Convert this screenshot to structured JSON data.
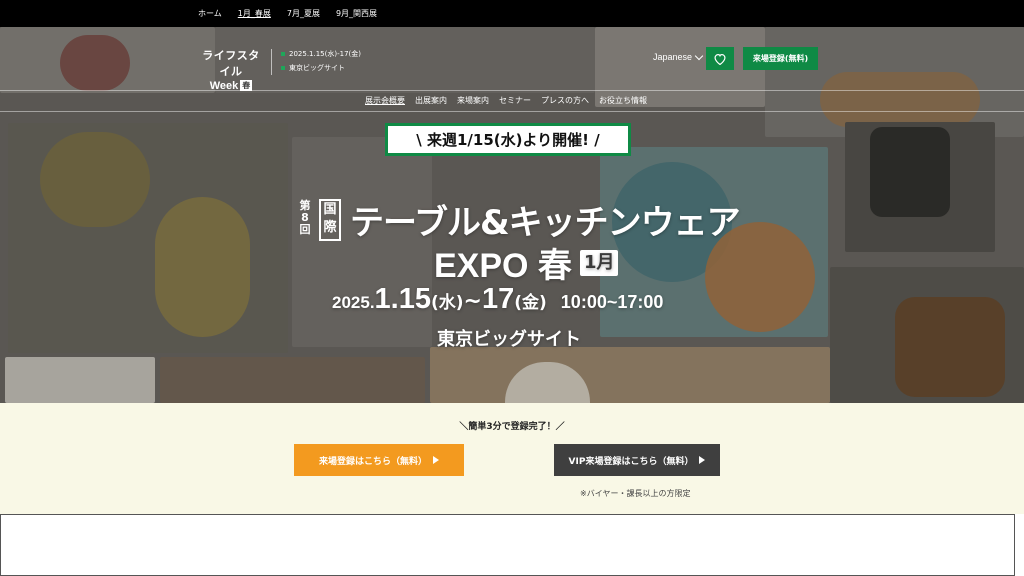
{
  "topnav": {
    "items": [
      {
        "label": "ホーム"
      },
      {
        "label": "1月_春展"
      },
      {
        "label": "7月_夏展"
      },
      {
        "label": "9月_関西展"
      }
    ]
  },
  "header": {
    "brand_line1": "ライフスタイル",
    "brand_line2": "Week",
    "brand_season": "春",
    "info_date": "2025.1.15(水)-17(金)",
    "info_venue": "東京ビッグサイト",
    "language": "Japanese",
    "register_label": "来場登録(無料)"
  },
  "subnav": {
    "items": [
      {
        "label": "展示会概要"
      },
      {
        "label": "出展案内"
      },
      {
        "label": "来場案内"
      },
      {
        "label": "セミナー"
      },
      {
        "label": "プレスの方へ"
      },
      {
        "label": "お役立ち情報"
      }
    ]
  },
  "hero": {
    "announce": "\\ 来週1/15(水)より開催! /",
    "edition": "第8回",
    "kokusai": "国際",
    "title_line1": "テーブル&キッチンウェア",
    "title_line2": "EXPO 春",
    "month_badge": "1月",
    "year": "2025.",
    "start_day": "1.15",
    "start_dow": "(水)",
    "tilde": "~",
    "end_day": "17",
    "end_dow": "(金)",
    "hours": "10:00~17:00",
    "venue": "東京ビッグサイト"
  },
  "cta": {
    "heading": "＼簡単3分で登録完了！／",
    "register_button": "来場登録はこちら（無料）",
    "vip_button": "VIP来場登録はこちら（無料）",
    "note": "※バイヤー・課長以上の方限定"
  },
  "colors": {
    "accent_green": "#0f8a45",
    "accent_orange": "#f39a1f",
    "dark_button": "#3f3f3f",
    "cta_background": "#f9f8e6"
  }
}
